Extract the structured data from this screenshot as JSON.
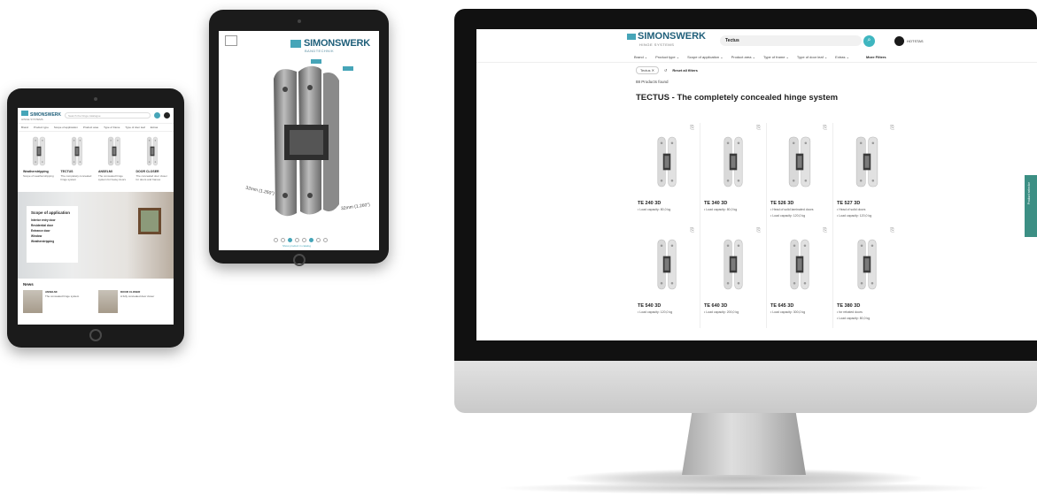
{
  "brand": {
    "name": "SIMONSWERK",
    "desktop_subtitle": "HINGE SYSTEMS",
    "tablet_subtitle": "BANDTECHNIK",
    "accent_color": "#46a5b8",
    "brand_color": "#1f5f7a"
  },
  "left_tablet": {
    "brand": "SIMONSWERK",
    "subtitle": "HINGE SYSTEMS",
    "search_placeholder": "Search the hinge catalogue",
    "nav": [
      "Brand",
      "Product type",
      "Scope of application",
      "Product area",
      "Type of frame",
      "Type of door leaf",
      "Extras"
    ],
    "products": [
      {
        "name": "Weatherstripping",
        "desc": "Scope of weatherstripping"
      },
      {
        "name": "TECTUS",
        "desc": "The completely concealed hinge system"
      },
      {
        "name": "ANSELMI",
        "desc": "The concealed hinge system for heavy doors"
      },
      {
        "name": "DOOR CLOSER",
        "desc": "The concealed door closer for doors and frames"
      }
    ],
    "scope": {
      "title": "Scope of application",
      "items": [
        "Interior entry door",
        "Residential door",
        "Entrance door",
        "Window",
        "Weatherstripping"
      ]
    },
    "news": {
      "title": "News",
      "items": [
        {
          "title": "ANSELMI",
          "text": "The concealed hinge system"
        },
        {
          "title": "DOOR CLOSER",
          "text": "A fully concealed door closer"
        }
      ]
    }
  },
  "right_tablet": {
    "brand": "SIMONSWERK",
    "subtitle": "BANDTECHNIK",
    "dimension_1": "32mm (1.260\")",
    "dimension_2": "32mm (1.260\")",
    "link_text": "Show product in catalog"
  },
  "desktop": {
    "search_value": "Tectus",
    "user_label": "HOTSTAS",
    "filters": [
      "Brand",
      "Product type",
      "Scope of application",
      "Product area",
      "Type of frame",
      "Type of door leaf",
      "Extras"
    ],
    "more_filters": "More Filters",
    "active_chip": "Tectus",
    "reset_label": "Reset all filters",
    "products_found": "88 Products found",
    "page_title": "TECTUS - The completely concealed hinge system",
    "side_tab_label": "Product selector",
    "products": [
      {
        "name": "TE 240 3D",
        "specs": [
          "• Load capacity: 80,0 kg"
        ]
      },
      {
        "name": "TE 340 3D",
        "specs": [
          "• Load capacity: 80,0 kg"
        ]
      },
      {
        "name": "TE 526 3D",
        "specs": [
          "• Head of solid laminated doors",
          "• Load capacity: 120,0 kg"
        ]
      },
      {
        "name": "TE 527 3D",
        "specs": [
          "• Head of solid doors",
          "• Load capacity: 120,0 kg"
        ]
      },
      {
        "name": "TE 540 3D",
        "specs": [
          "• Load capacity: 120,0 kg"
        ]
      },
      {
        "name": "TE 640 3D",
        "specs": [
          "• Load capacity: 200,0 kg"
        ]
      },
      {
        "name": "TE 645 3D",
        "specs": [
          "• Load capacity: 300,0 kg"
        ]
      },
      {
        "name": "TE 380 3D",
        "specs": [
          "• for rebated doors",
          "• Load capacity: 80,0 kg"
        ]
      }
    ]
  }
}
